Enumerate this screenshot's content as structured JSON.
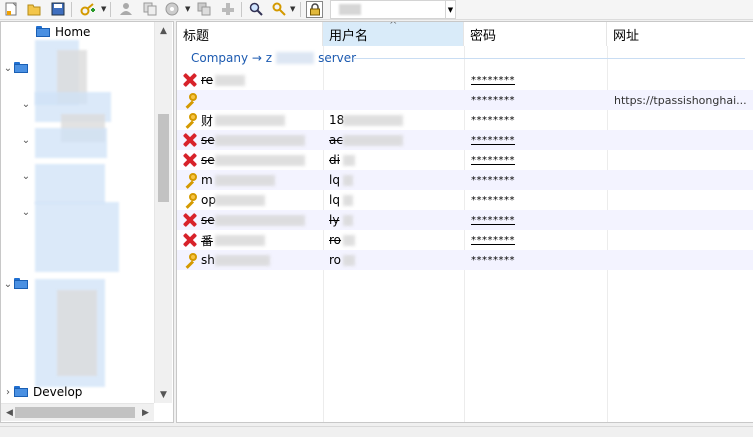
{
  "toolbar": {
    "buttons": [
      "new-database-icon",
      "open-folder-icon",
      "save-icon",
      "add-entry-icon",
      "user-icon",
      "copy-icon",
      "disk-icon",
      "clone-icon",
      "tools-icon",
      "search-icon",
      "key-generate-icon",
      "lock-icon"
    ],
    "combo_value": ""
  },
  "tree": {
    "home": "Home",
    "develop": "Develop"
  },
  "list": {
    "columns": [
      "标题",
      "用户名",
      "密码",
      "网址"
    ],
    "sort_indicator": "^",
    "group_prefix": "Company → z",
    "group_suffix": "server",
    "rows": [
      {
        "icon": "expired",
        "title": "re",
        "user": "",
        "password": "********",
        "url": ""
      },
      {
        "icon": "key",
        "title": "",
        "user": "",
        "password": "********",
        "url": "https://tpassishonghai..."
      },
      {
        "icon": "key",
        "title": "财",
        "user": "18",
        "password": "********",
        "url": ""
      },
      {
        "icon": "expired",
        "title": "se",
        "user": "ac",
        "password": "********",
        "url": ""
      },
      {
        "icon": "expired",
        "title": "se",
        "user": "di",
        "password": "********",
        "url": ""
      },
      {
        "icon": "key",
        "title": "m",
        "user": "lq",
        "password": "********",
        "url": ""
      },
      {
        "icon": "key",
        "title": "op",
        "user": "lq",
        "password": "********",
        "url": ""
      },
      {
        "icon": "expired",
        "title": "se",
        "user": "ly",
        "password": "********",
        "url": ""
      },
      {
        "icon": "expired",
        "title": "番",
        "user": "ro",
        "password": "********",
        "url": ""
      },
      {
        "icon": "key",
        "title": "sh",
        "user": "ro",
        "password": "********",
        "url": ""
      }
    ]
  },
  "colors": {
    "accent": "#1c5ab0",
    "expired": "#d8232a",
    "key": "#d49a00",
    "sorted_header": "#d9ebf9"
  }
}
